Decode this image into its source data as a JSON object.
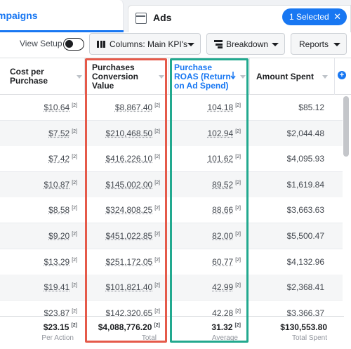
{
  "tabs": {
    "campaigns_label": "mpaigns",
    "ads_label": "Ads",
    "selected_pill": "1 Selected",
    "selected_close": "✕"
  },
  "toolbar": {
    "view_setup_label": "View Setup",
    "columns_label": "Columns: Main KPI's",
    "breakdown_label": "Breakdown",
    "reports_label": "Reports"
  },
  "columns": {
    "cost_per_purchase": [
      "Cost per",
      "Purchase"
    ],
    "purchases_conversion_value": [
      "Purchases",
      "Conversion",
      "Value"
    ],
    "purchase_roas": [
      "Purchase",
      "ROAS (Return",
      "on Ad Spend)"
    ],
    "amount_spent": "Amount Spent",
    "add_column": "+"
  },
  "rows": [
    {
      "cost": "$10.64",
      "conv": "$8,867.40",
      "roas": "104.18",
      "spent": "$85.12"
    },
    {
      "cost": "$7.52",
      "conv": "$210,468.50",
      "roas": "102.94",
      "spent": "$2,044.48"
    },
    {
      "cost": "$7.42",
      "conv": "$416,226.10",
      "roas": "101.62",
      "spent": "$4,095.93"
    },
    {
      "cost": "$10.87",
      "conv": "$145,002.00",
      "roas": "89.52",
      "spent": "$1,619.84"
    },
    {
      "cost": "$8.58",
      "conv": "$324,808.25",
      "roas": "88.66",
      "spent": "$3,663.63"
    },
    {
      "cost": "$9.20",
      "conv": "$451,022.85",
      "roas": "82.00",
      "spent": "$5,500.47"
    },
    {
      "cost": "$13.29",
      "conv": "$251,172.05",
      "roas": "60.77",
      "spent": "$4,132.96"
    },
    {
      "cost": "$19.41",
      "conv": "$101,821.40",
      "roas": "42.99",
      "spent": "$2,368.41"
    },
    {
      "cost": "$23.87",
      "conv": "$142,320.65",
      "roas": "42.28",
      "spent": "$3,366.37"
    }
  ],
  "footnote_marker": "[2]",
  "footer": {
    "cost_total": "$23.15",
    "cost_sub": "Per Action",
    "conv_total": "$4,088,776.20",
    "conv_sub": "Total",
    "roas_total": "31.32",
    "roas_sub": "Average",
    "spent_total": "$130,553.80",
    "spent_sub": "Total Spent"
  },
  "colors": {
    "accent": "#1877f2",
    "highlight_red": "#e55a4a",
    "highlight_teal": "#22a98f"
  },
  "icons": [
    "window-icon",
    "columns-icon",
    "breakdown-icon",
    "sort-down-icon",
    "plus-circle-icon",
    "close-icon"
  ]
}
